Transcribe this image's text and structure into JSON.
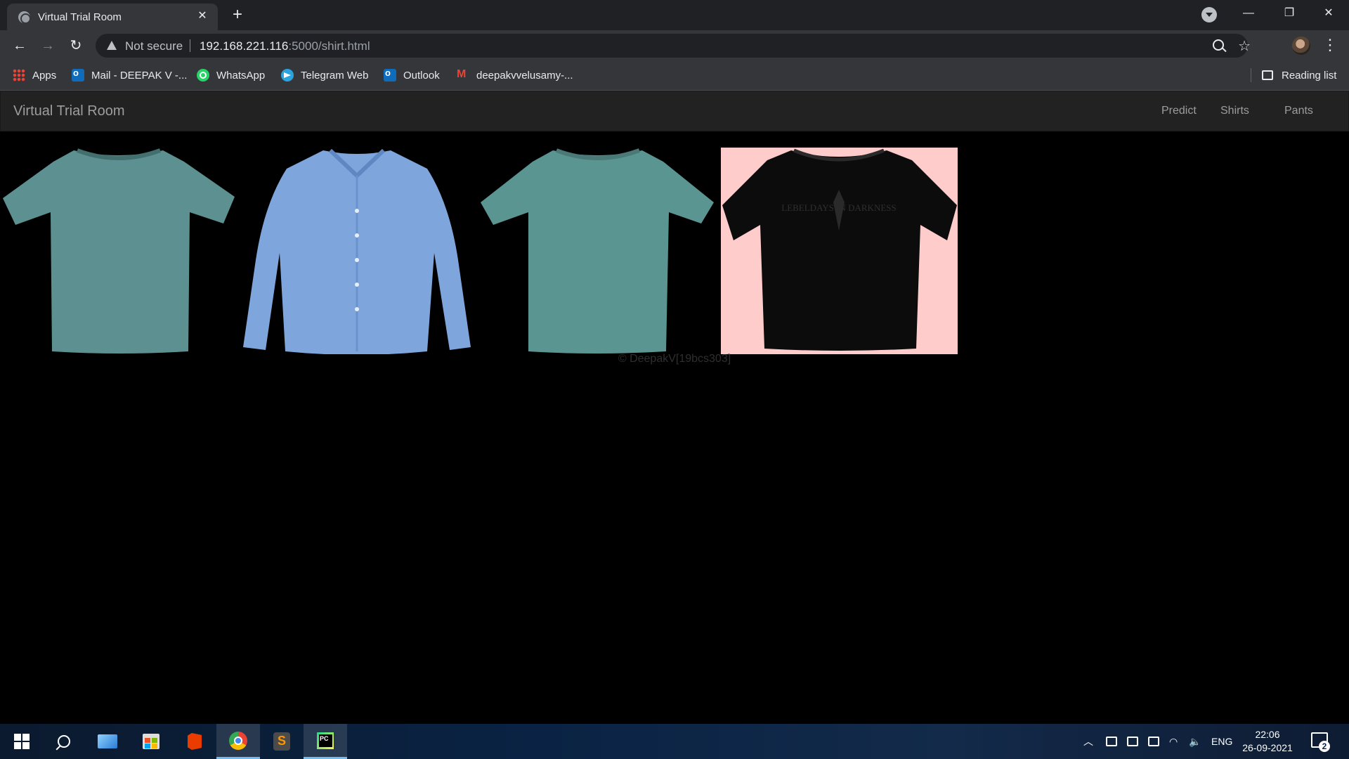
{
  "browser": {
    "tab": {
      "title": "Virtual Trial Room"
    },
    "address": {
      "security": "Not secure",
      "host": "192.168.221.116",
      "path": ":5000/shirt.html"
    },
    "bookmarks": [
      {
        "label": "Apps",
        "icon": "apps-grid-icon"
      },
      {
        "label": "Mail - DEEPAK V -...",
        "icon": "outlook-icon"
      },
      {
        "label": "WhatsApp",
        "icon": "whatsapp-icon"
      },
      {
        "label": "Telegram Web",
        "icon": "telegram-icon"
      },
      {
        "label": "Outlook",
        "icon": "outlook-icon"
      },
      {
        "label": "deepakvvelusamy-...",
        "icon": "gmail-icon"
      }
    ],
    "reading_list": "Reading list"
  },
  "site": {
    "brand": "Virtual Trial Room",
    "nav": [
      "Predict",
      "Shirts",
      "Pants"
    ],
    "products": [
      {
        "name": "teal crew-neck t-shirt",
        "color": "#5d9191"
      },
      {
        "name": "light blue button-down shirt",
        "color": "#7ea6dc"
      },
      {
        "name": "teal crew-neck t-shirt",
        "color": "#5b9592"
      },
      {
        "name": "black printed t-shirt",
        "color": "#0c0c0c",
        "background": "#ffcccc",
        "print": "LEBELDAYS IN DARKNESS"
      }
    ],
    "footer": "© DeepakV[19bcs303]"
  },
  "taskbar": {
    "apps": [
      "start-icon",
      "search-icon",
      "this-pc-icon",
      "store-icon",
      "office-icon",
      "chrome-icon",
      "sublime-text-icon",
      "pycharm-icon"
    ],
    "language": "ENG",
    "time": "22:06",
    "date": "26-09-2021",
    "notifications": "2"
  }
}
